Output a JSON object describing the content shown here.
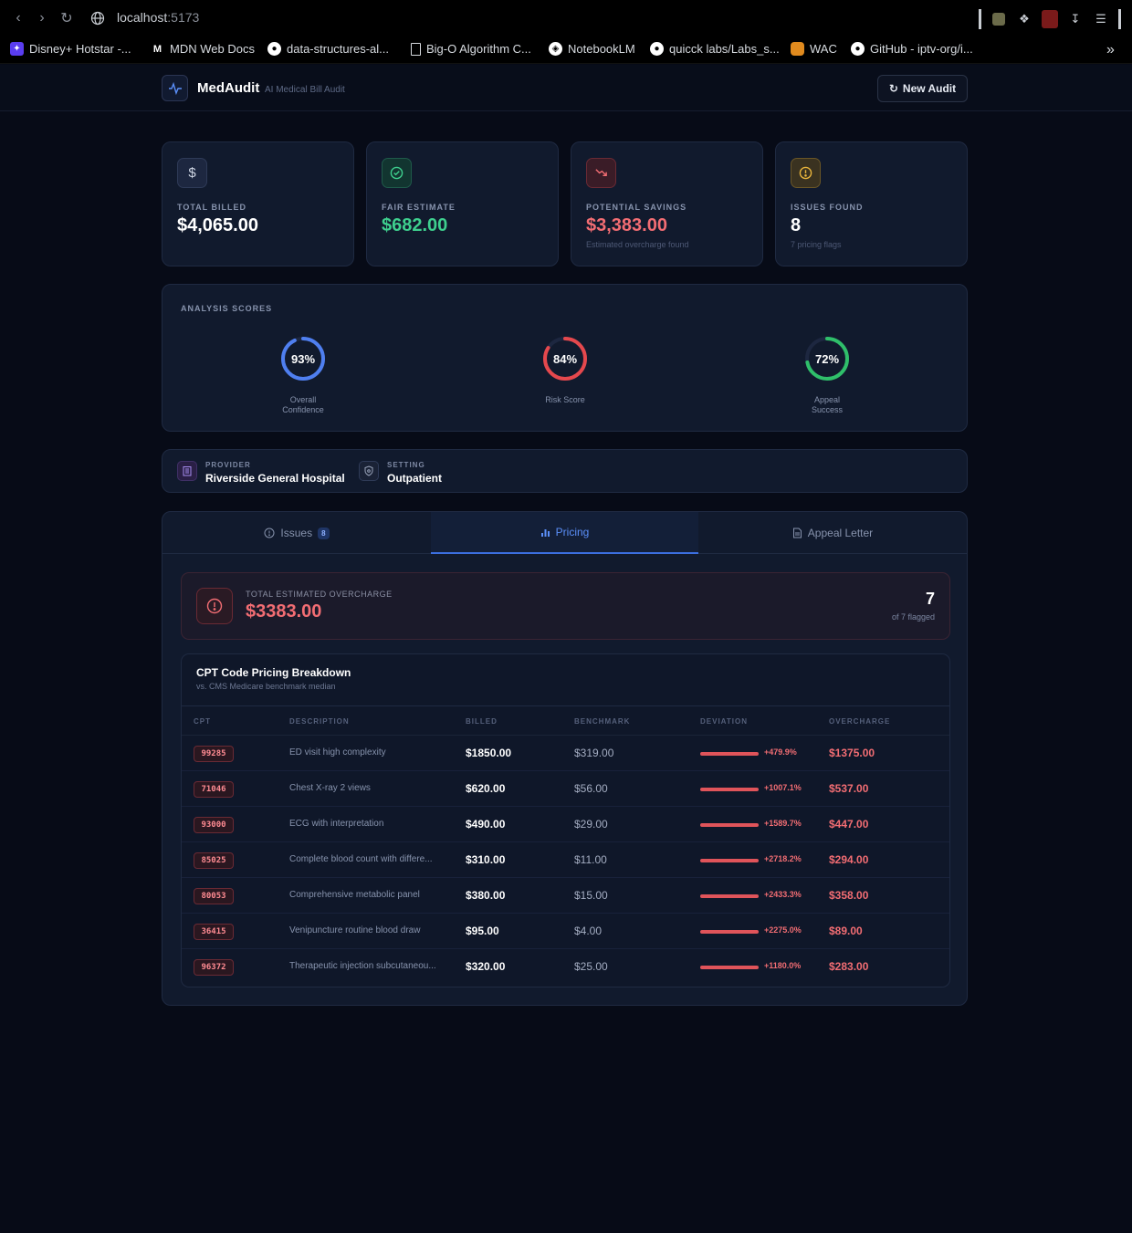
{
  "browser": {
    "url_host": "localhost",
    "url_port": ":5173",
    "bookmarks": [
      {
        "label": "Disney+ Hotstar -...",
        "icon": "disney-icon"
      },
      {
        "label": "MDN Web Docs",
        "icon": "mdn-icon"
      },
      {
        "label": "data-structures-al...",
        "icon": "github-icon"
      },
      {
        "label": "Big-O Algorithm C...",
        "icon": "page-icon"
      },
      {
        "label": "NotebookLM",
        "icon": "notebooklm-icon"
      },
      {
        "label": "quicck labs/Labs_s...",
        "icon": "github-icon"
      },
      {
        "label": "WAC",
        "icon": "wac-icon"
      },
      {
        "label": "GitHub - iptv-org/i...",
        "icon": "github-icon"
      }
    ]
  },
  "header": {
    "brand": "MedAudit",
    "subtitle": "AI Medical Bill Audit",
    "new_audit": "New Audit"
  },
  "stats": [
    {
      "label": "TOTAL BILLED",
      "value": "$4,065.00",
      "sub": "",
      "icon": "dollar-icon",
      "color": "#ffffff"
    },
    {
      "label": "FAIR ESTIMATE",
      "value": "$682.00",
      "sub": "",
      "icon": "check-circle-icon",
      "color": "#3ecf8e"
    },
    {
      "label": "POTENTIAL SAVINGS",
      "value": "$3,383.00",
      "sub": "Estimated overcharge found",
      "icon": "trending-down-icon",
      "color": "#f26d73"
    },
    {
      "label": "ISSUES FOUND",
      "value": "8",
      "sub": "7 pricing flags",
      "icon": "alert-circle-icon",
      "color": "#ffffff"
    }
  ],
  "scores": {
    "title": "ANALYSIS SCORES",
    "items": [
      {
        "value_text": "93%",
        "value": 0.93,
        "label_1": "Overall",
        "label_2": "Confidence",
        "color": "#4f7ff0"
      },
      {
        "value_text": "84%",
        "value": 0.84,
        "label_1": "Risk Score",
        "label_2": "",
        "color": "#e5484d"
      },
      {
        "value_text": "72%",
        "value": 0.72,
        "label_1": "Appeal",
        "label_2": "Success",
        "color": "#2fbf6a"
      }
    ]
  },
  "provider": {
    "provider_label": "PROVIDER",
    "provider_value": "Riverside General Hospital",
    "setting_label": "SETTING",
    "setting_value": "Outpatient"
  },
  "tabs": {
    "issues": "Issues",
    "issues_count": "8",
    "pricing": "Pricing",
    "appeal": "Appeal Letter"
  },
  "overcharge": {
    "label": "TOTAL ESTIMATED OVERCHARGE",
    "value": "$3383.00",
    "count": "7",
    "of_text": "of 7 flagged"
  },
  "table": {
    "title": "CPT Code Pricing Breakdown",
    "subtitle": "vs. CMS Medicare benchmark median",
    "headers": [
      "CPT",
      "DESCRIPTION",
      "BILLED",
      "BENCHMARK",
      "DEVIATION",
      "OVERCHARGE"
    ],
    "rows": [
      {
        "cpt": "99285",
        "desc": "ED visit high complexity",
        "billed": "$1850.00",
        "bench": "$319.00",
        "dev": "+479.9%",
        "over": "$1375.00"
      },
      {
        "cpt": "71046",
        "desc": "Chest X-ray 2 views",
        "billed": "$620.00",
        "bench": "$56.00",
        "dev": "+1007.1%",
        "over": "$537.00"
      },
      {
        "cpt": "93000",
        "desc": "ECG with interpretation",
        "billed": "$490.00",
        "bench": "$29.00",
        "dev": "+1589.7%",
        "over": "$447.00"
      },
      {
        "cpt": "85025",
        "desc": "Complete blood count with differe...",
        "billed": "$310.00",
        "bench": "$11.00",
        "dev": "+2718.2%",
        "over": "$294.00"
      },
      {
        "cpt": "80053",
        "desc": "Comprehensive metabolic panel",
        "billed": "$380.00",
        "bench": "$15.00",
        "dev": "+2433.3%",
        "over": "$358.00"
      },
      {
        "cpt": "36415",
        "desc": "Venipuncture routine blood draw",
        "billed": "$95.00",
        "bench": "$4.00",
        "dev": "+2275.0%",
        "over": "$89.00"
      },
      {
        "cpt": "96372",
        "desc": "Therapeutic injection subcutaneou...",
        "billed": "$320.00",
        "bench": "$25.00",
        "dev": "+1180.0%",
        "over": "$283.00"
      }
    ]
  }
}
